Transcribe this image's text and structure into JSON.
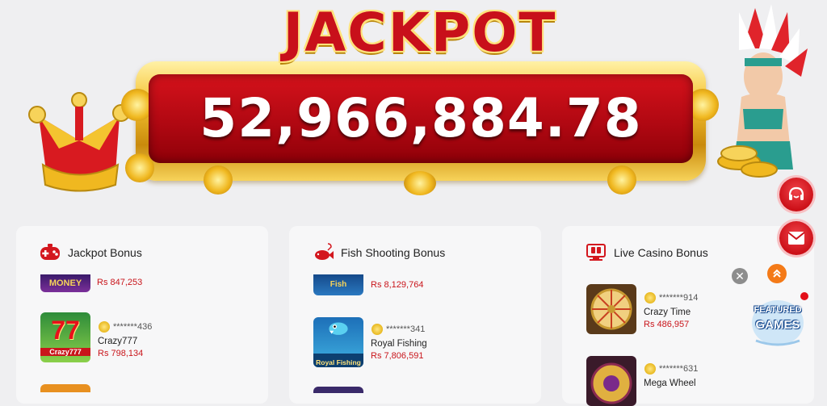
{
  "jackpot": {
    "title": "JACKPOT",
    "amount": "52,966,884.78"
  },
  "cards": [
    {
      "title": "Jackpot Bonus",
      "icon": "gamepad-icon",
      "entries": [
        {
          "thumb_text": "MONEY POT",
          "user": "",
          "game": "",
          "amount": "Rs 847,253"
        },
        {
          "thumb_text": "77 Crazy777",
          "user": "*******436",
          "game": "Crazy777",
          "amount": "Rs 798,134"
        }
      ]
    },
    {
      "title": "Fish Shooting Bonus",
      "icon": "fish-icon",
      "entries": [
        {
          "thumb_text": "Fish JACKPOT",
          "user": "",
          "game": "",
          "amount": "Rs 8,129,764"
        },
        {
          "thumb_text": "Royal Fishing",
          "user": "*******341",
          "game": "Royal Fishing",
          "amount": "Rs 7,806,591"
        }
      ]
    },
    {
      "title": "Live Casino Bonus",
      "icon": "live-casino-icon",
      "entries": [
        {
          "thumb_text": "",
          "user": "*******914",
          "game": "Crazy Time",
          "amount": "Rs 486,957"
        },
        {
          "thumb_text": "",
          "user": "*******631",
          "game": "Mega Wheel",
          "amount": ""
        }
      ]
    }
  ],
  "floating": {
    "support_icon": "headset-icon",
    "mail_icon": "mail-icon",
    "close_label": "✕",
    "featured_label_1": "FEATURED",
    "featured_label_2": "GAMES"
  },
  "colors": {
    "accent_red": "#c9151b",
    "gold": "#f5c230",
    "background": "#efeff1"
  }
}
